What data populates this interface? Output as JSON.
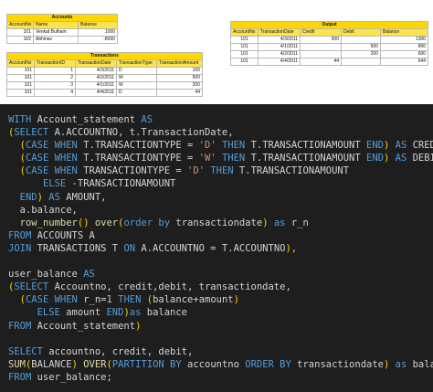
{
  "accounts": {
    "title": "Accounts",
    "headers": [
      "AccountNo",
      "Name",
      "Balance"
    ],
    "rows": [
      [
        "101",
        "Venkat Bulham",
        "1000"
      ],
      [
        "102",
        "Abhinav",
        "-8000"
      ]
    ]
  },
  "transactions": {
    "title": "Transactions",
    "headers": [
      "AccountNo",
      "TransactionID",
      "TransactionDate",
      "TransactionType",
      "TransactionAmount"
    ],
    "rows": [
      [
        "101",
        "1",
        "4/3/2011",
        "D",
        "100"
      ],
      [
        "101",
        "2",
        "4/2/2011",
        "W",
        "500"
      ],
      [
        "101",
        "3",
        "4/1/2011",
        "W",
        "200"
      ],
      [
        "101",
        "4",
        "4/4/2011",
        "D",
        "44"
      ]
    ]
  },
  "output": {
    "title": "Output",
    "headers": [
      "AccountNo",
      "TransactionDate",
      "Credit",
      "Debit",
      "Balance"
    ],
    "rows": [
      [
        "101",
        "4/3/2011",
        "300",
        "",
        "1300"
      ],
      [
        "101",
        "4/1/2011",
        "",
        "500",
        "800"
      ],
      [
        "101",
        "4/2/2011",
        "",
        "200",
        "600"
      ],
      [
        "101",
        "4/4/2011",
        "44",
        "",
        "644"
      ]
    ]
  },
  "code": {
    "lines": [
      [
        [
          "kw",
          "WITH "
        ],
        [
          "id",
          "Account_statement "
        ],
        [
          "kw",
          "AS"
        ]
      ],
      [
        [
          "pn",
          "("
        ],
        [
          "kw",
          "SELECT "
        ],
        [
          "id",
          "A.ACCOUNTNO, t.TransactionDate,"
        ]
      ],
      [
        [
          "id",
          "  "
        ],
        [
          "pn",
          "("
        ],
        [
          "kw",
          "CASE WHEN "
        ],
        [
          "id",
          "T.TRANSACTIONTYPE "
        ],
        [
          "op",
          "= "
        ],
        [
          "st",
          "'D' "
        ],
        [
          "kw",
          "THEN "
        ],
        [
          "id",
          "T.TRANSACTIONAMOUNT "
        ],
        [
          "kw",
          "END"
        ],
        [
          "pn",
          ") "
        ],
        [
          "kw",
          "AS "
        ],
        [
          "id",
          "CREDIT,"
        ]
      ],
      [
        [
          "id",
          "  "
        ],
        [
          "pn",
          "("
        ],
        [
          "kw",
          "CASE WHEN "
        ],
        [
          "id",
          "T.TRANSACTIONTYPE "
        ],
        [
          "op",
          "= "
        ],
        [
          "st",
          "'W' "
        ],
        [
          "kw",
          "THEN "
        ],
        [
          "id",
          "T.TRANSACTIONAMOUNT "
        ],
        [
          "kw",
          "END"
        ],
        [
          "pn",
          ") "
        ],
        [
          "kw",
          "AS "
        ],
        [
          "id",
          "DEBIT,"
        ]
      ],
      [
        [
          "id",
          "  "
        ],
        [
          "pn",
          "("
        ],
        [
          "kw",
          "CASE WHEN "
        ],
        [
          "id",
          "TRANSACTIONTYPE "
        ],
        [
          "op",
          "= "
        ],
        [
          "st",
          "'D' "
        ],
        [
          "kw",
          "THEN "
        ],
        [
          "id",
          "T.TRANSACTIONAMOUNT"
        ]
      ],
      [
        [
          "id",
          "      "
        ],
        [
          "kw",
          "ELSE "
        ],
        [
          "op",
          "-"
        ],
        [
          "id",
          "TRANSACTIONAMOUNT"
        ]
      ],
      [
        [
          "id",
          "  "
        ],
        [
          "kw",
          "END"
        ],
        [
          "pn",
          ") "
        ],
        [
          "kw",
          "AS "
        ],
        [
          "id",
          "AMOUNT,"
        ]
      ],
      [
        [
          "id",
          "  a.balance,"
        ]
      ],
      [
        [
          "id",
          "  "
        ],
        [
          "fn",
          "row_number"
        ],
        [
          "pn",
          "() "
        ],
        [
          "fn",
          "over"
        ],
        [
          "pn",
          "("
        ],
        [
          "kw",
          "order by "
        ],
        [
          "id",
          "transactiondate"
        ],
        [
          "pn",
          ") "
        ],
        [
          "kw",
          "as "
        ],
        [
          "id",
          "r_n"
        ]
      ],
      [
        [
          "kw",
          "FROM "
        ],
        [
          "id",
          "ACCOUNTS A"
        ]
      ],
      [
        [
          "kw",
          "JOIN "
        ],
        [
          "id",
          "TRANSACTIONS T "
        ],
        [
          "kw",
          "ON "
        ],
        [
          "id",
          "A.ACCOUNTNO "
        ],
        [
          "op",
          "= "
        ],
        [
          "id",
          "T.ACCOUNTNO"
        ],
        [
          "pn",
          "),"
        ]
      ],
      [
        [
          "id",
          ""
        ]
      ],
      [
        [
          "id",
          "user_balance "
        ],
        [
          "kw",
          "AS"
        ]
      ],
      [
        [
          "pn",
          "("
        ],
        [
          "kw",
          "SELECT "
        ],
        [
          "id",
          "Accountno, credit,debit, transactiondate,"
        ]
      ],
      [
        [
          "id",
          "  "
        ],
        [
          "pn",
          "("
        ],
        [
          "kw",
          "CASE WHEN "
        ],
        [
          "id",
          "r_n"
        ],
        [
          "op",
          "="
        ],
        [
          "nu",
          "1 "
        ],
        [
          "kw",
          "THEN "
        ],
        [
          "pn",
          "("
        ],
        [
          "id",
          "balance"
        ],
        [
          "op",
          "+"
        ],
        [
          "id",
          "amount"
        ],
        [
          "pn",
          ")"
        ]
      ],
      [
        [
          "id",
          "     "
        ],
        [
          "kw",
          "ELSE "
        ],
        [
          "id",
          "amount "
        ],
        [
          "kw",
          "END"
        ],
        [
          "pn",
          ")"
        ],
        [
          "kw",
          "as "
        ],
        [
          "id",
          "balance"
        ]
      ],
      [
        [
          "kw",
          "FROM "
        ],
        [
          "id",
          "Account_statement"
        ],
        [
          "pn",
          ")"
        ]
      ],
      [
        [
          "id",
          ""
        ]
      ],
      [
        [
          "kw",
          "SELECT "
        ],
        [
          "id",
          "accountno, credit, debit,"
        ]
      ],
      [
        [
          "fn",
          "SUM"
        ],
        [
          "pn",
          "("
        ],
        [
          "id",
          "BALANCE"
        ],
        [
          "pn",
          ") "
        ],
        [
          "fn",
          "OVER"
        ],
        [
          "pn",
          "("
        ],
        [
          "kw",
          "PARTITION BY "
        ],
        [
          "id",
          "accountno "
        ],
        [
          "kw",
          "ORDER BY "
        ],
        [
          "id",
          "transactiondate"
        ],
        [
          "pn",
          ") "
        ],
        [
          "kw",
          "as "
        ],
        [
          "id",
          "balance"
        ]
      ],
      [
        [
          "kw",
          "FROM "
        ],
        [
          "id",
          "user_balance;"
        ]
      ]
    ]
  }
}
